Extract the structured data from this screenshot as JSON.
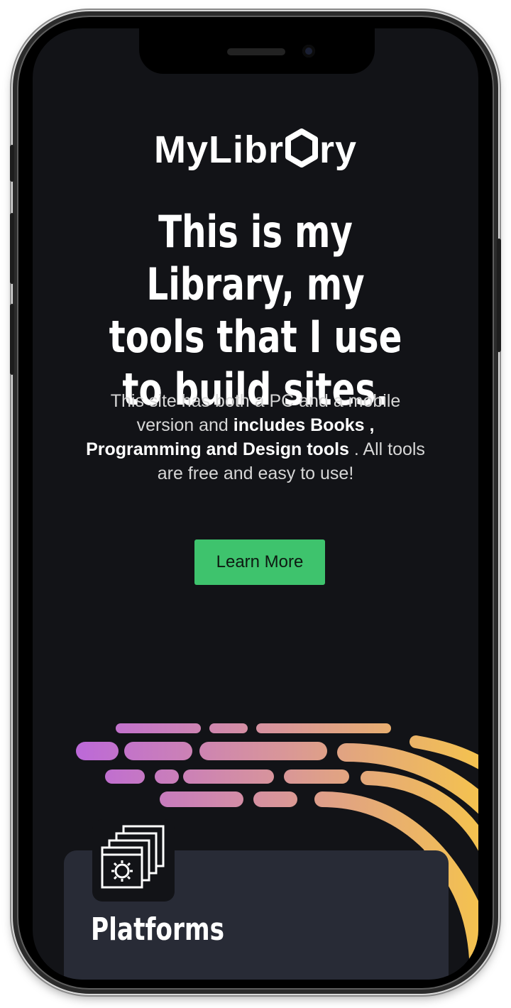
{
  "brand": {
    "logo_prefix": "MyLibr",
    "logo_suffix": "ry"
  },
  "hero": {
    "headline": "This is my Library, my tools that I use to build sites.",
    "desc_part1": "This site has both a PC and a mobile version and ",
    "desc_bold": "includes Books , Programming and Design tools",
    "desc_part2": " . All tools are free and easy to use!"
  },
  "cta": {
    "label": "Learn More"
  },
  "card": {
    "title": "Platforms",
    "icon": "windows-settings-icon"
  },
  "colors": {
    "background": "#121317",
    "accent": "#3ec36d",
    "card": "#282b36",
    "gradient_start": "#b65fe6",
    "gradient_end": "#f4c24f"
  }
}
